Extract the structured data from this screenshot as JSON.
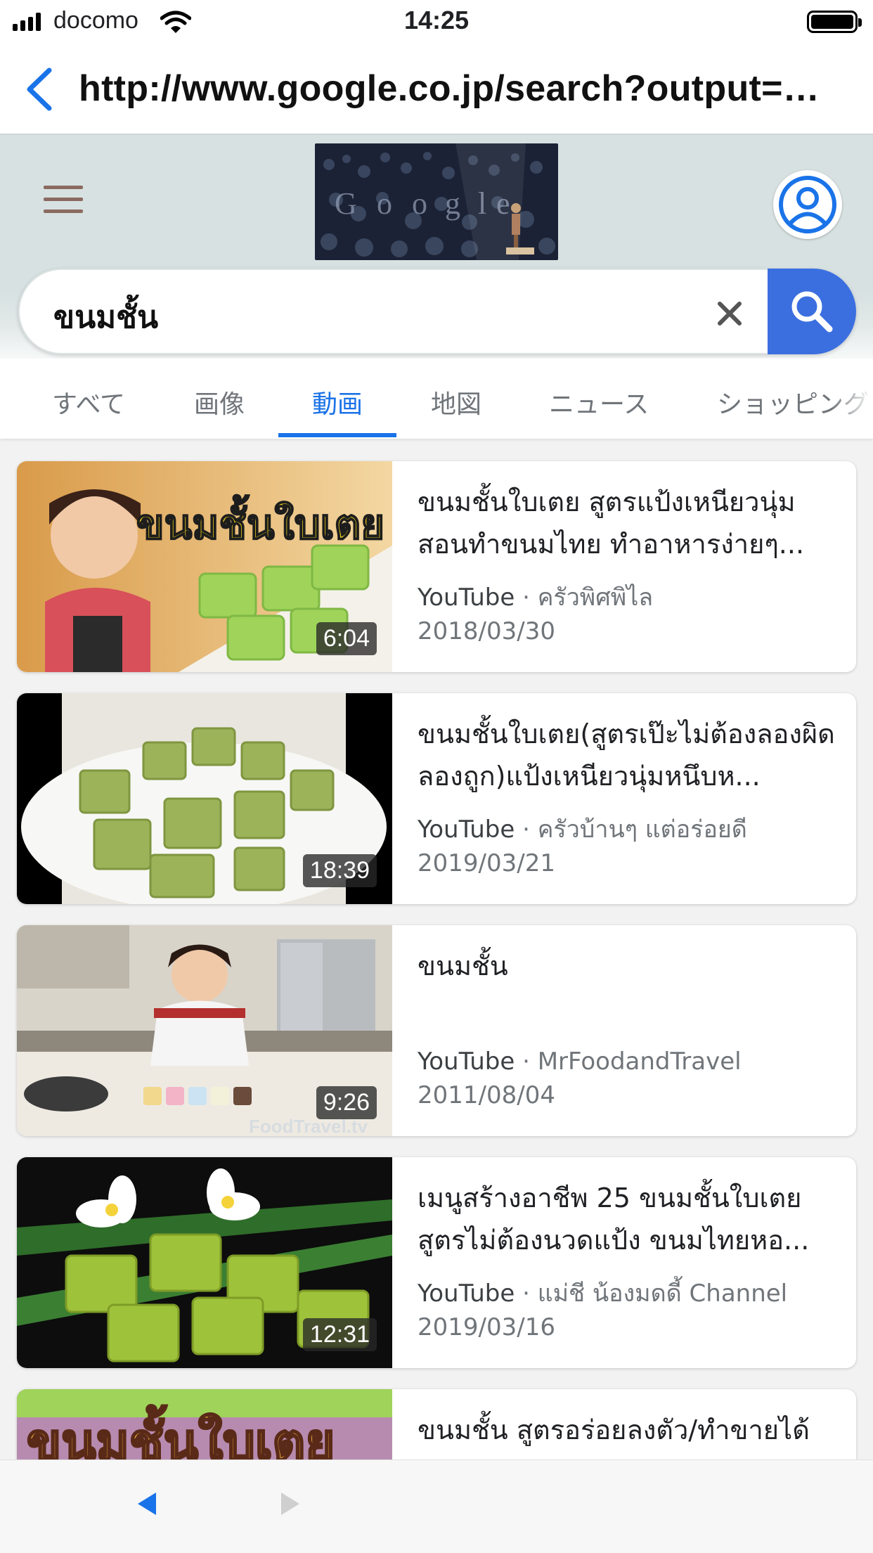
{
  "status_bar": {
    "carrier": "docomo",
    "time": "14:25"
  },
  "browser": {
    "url": "http://www.google.co.jp/search?output=&s..."
  },
  "search": {
    "query": "ขนมชั้น"
  },
  "tabs": [
    {
      "label": "すべて",
      "active": false
    },
    {
      "label": "画像",
      "active": false
    },
    {
      "label": "動画",
      "active": true
    },
    {
      "label": "地図",
      "active": false
    },
    {
      "label": "ニュース",
      "active": false
    },
    {
      "label": "ショッピング",
      "active": false
    }
  ],
  "results": [
    {
      "title": "ขนมชั้นใบเตย สูตรแป้งเหนียวนุ่ม สอนทำขนมไทย ทำอาหารง่ายๆ...",
      "source": "YouTube",
      "channel": " · ครัวพิศพิไล",
      "date": "2018/03/30",
      "duration": "6:04",
      "thumb_text": "ขนมชั้นใบเตย"
    },
    {
      "title": "ขนมชั้นใบเตย(สูตรเป๊ะไม่ต้องลองผิดลองถูก)แป้งเหนียวนุ่มหนึบห...",
      "source": "YouTube",
      "channel": " · ครัวบ้านๆ แต่อร่อยดี",
      "date": "2019/03/21",
      "duration": "18:39"
    },
    {
      "title": "ขนมชั้น",
      "source": "YouTube",
      "channel": " · MrFoodandTravel",
      "date": "2011/08/04",
      "duration": "9:26",
      "thumb_text": "FoodTravel.tv"
    },
    {
      "title": "เมนูสร้างอาชีพ 25 ขนมชั้นใบเตย สูตรไม่ต้องนวดแป้ง ขนมไทยหอ...",
      "source": "YouTube",
      "channel": " · แม่ชี น้องมดดี้ Channel",
      "date": "2019/03/16",
      "duration": "12:31"
    },
    {
      "title": "ขนมชั้น สูตรอร่อยลงตัว/ทำขายได้",
      "source": "",
      "channel": "",
      "date": "",
      "duration": "",
      "thumb_text": "ขนมชั้นใบเตย"
    }
  ],
  "colors": {
    "accent": "#1a73e8",
    "search_button": "#3b6fe0",
    "header_bg": "#d7e1e1"
  },
  "icons": [
    "signal-icon",
    "wifi-icon",
    "battery-icon",
    "back-chevron-icon",
    "hamburger-icon",
    "google-doodle",
    "account-icon",
    "clear-icon",
    "search-icon",
    "nav-back-icon",
    "nav-forward-icon"
  ]
}
